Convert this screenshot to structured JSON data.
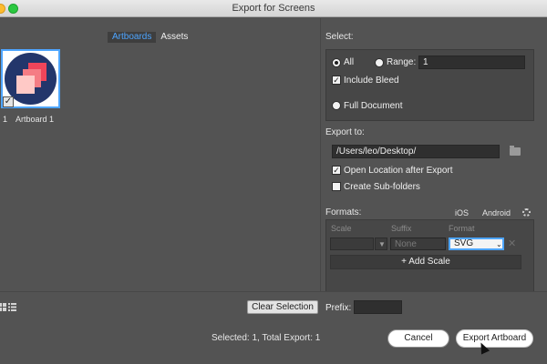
{
  "window": {
    "title": "Export for Screens"
  },
  "tabs": [
    {
      "label": "Artboards",
      "active": true
    },
    {
      "label": "Assets",
      "active": false
    }
  ],
  "artboards": [
    {
      "number": "1",
      "name": "Artboard 1",
      "checked": true
    }
  ],
  "select": {
    "label": "Select:",
    "all_label": "All",
    "range_label": "Range:",
    "range_value": "1",
    "include_bleed_label": "Include Bleed",
    "full_document_label": "Full Document"
  },
  "export_to": {
    "label": "Export to:",
    "path": "/Users/leo/Desktop/",
    "open_location_label": "Open Location after Export",
    "create_subfolders_label": "Create Sub-folders"
  },
  "formats": {
    "label": "Formats:",
    "ios_label": "iOS",
    "android_label": "Android",
    "headers": {
      "scale": "Scale",
      "suffix": "Suffix",
      "format": "Format"
    },
    "row": {
      "suffix_placeholder": "None",
      "format": "SVG"
    },
    "add_scale_label": "+ Add Scale"
  },
  "bottom": {
    "clear_selection_label": "Clear Selection",
    "prefix_label": "Prefix:",
    "status": "Selected: 1, Total Export: 1",
    "cancel_label": "Cancel",
    "export_label": "Export Artboard"
  },
  "colors": {
    "accent": "#4ea5ff",
    "background": "#535353",
    "panel": "#474747"
  }
}
